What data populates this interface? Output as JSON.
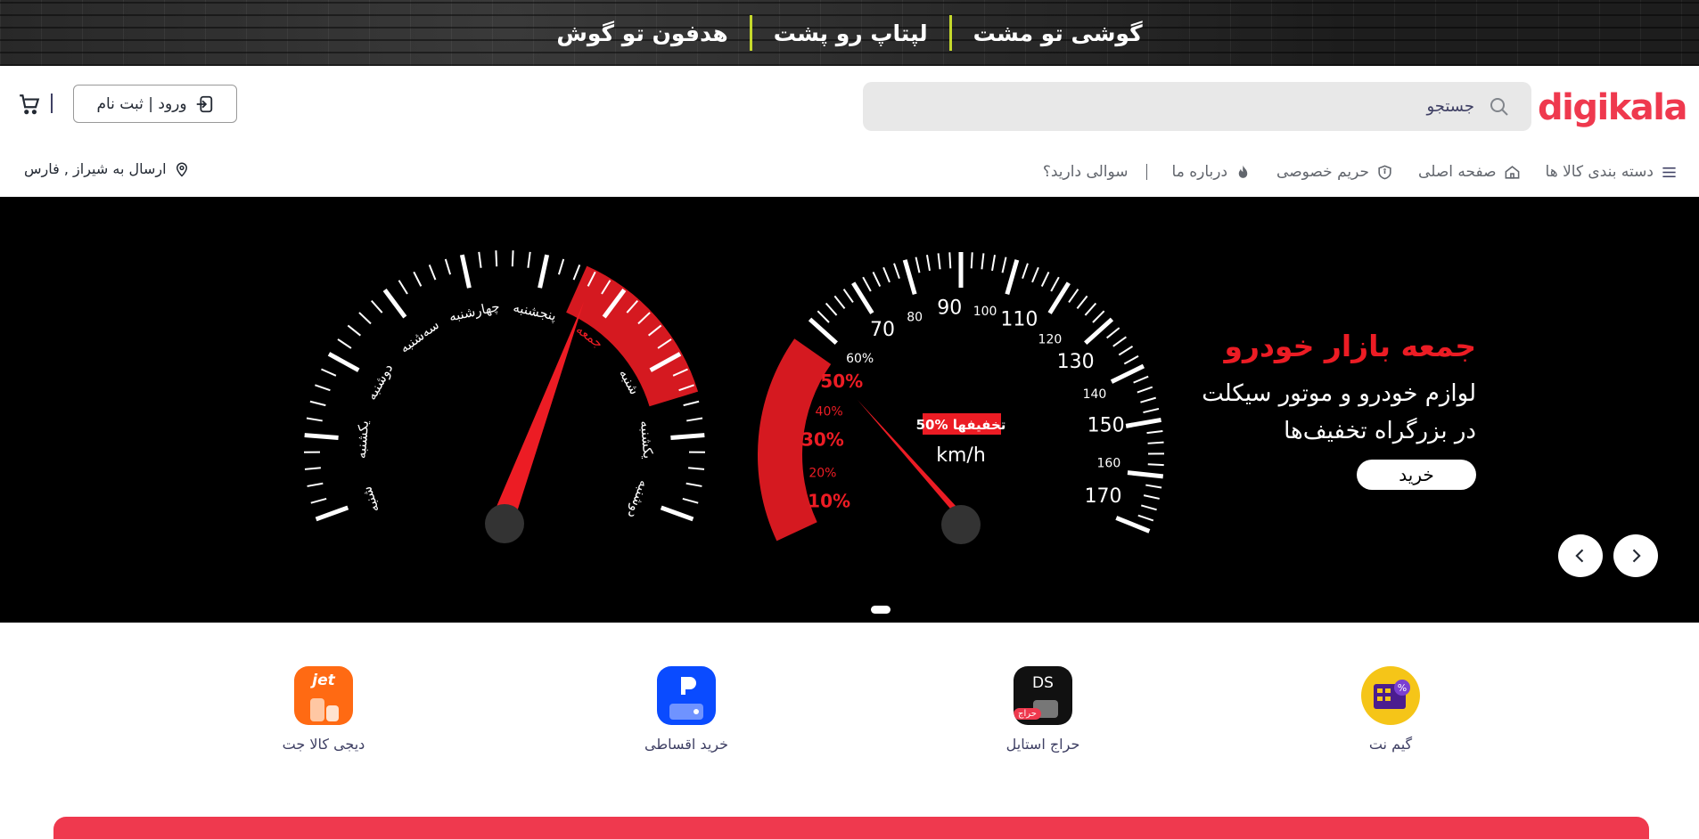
{
  "promo": {
    "items": [
      "گوشی تو مشت",
      "لپتاپ رو پشت",
      "هدفون تو گوش"
    ],
    "separator_color": "#c5d92c"
  },
  "header": {
    "logo": "digikala",
    "search_placeholder": "جستجو",
    "login_label": "ورود | ثبت نام",
    "cart_icon": "cart-icon"
  },
  "nav": {
    "items": [
      {
        "label": "دسته بندی کالا ها",
        "icon": "menu-icon"
      },
      {
        "label": "صفحه اصلی",
        "icon": "home-icon"
      },
      {
        "label": "حریم خصوصی",
        "icon": "shield-icon"
      },
      {
        "label": "درباره ما",
        "icon": "fire-icon"
      },
      {
        "label": "سوالی دارید؟",
        "icon": ""
      }
    ],
    "location": "ارسال به شیراز , فارس"
  },
  "hero": {
    "title": "جمعه بازار خودرو",
    "subtitle_line1": "لوازم خودرو و موتور سیکلت",
    "subtitle_line2": "در بزرگراه تخفیف‌ها",
    "button": "خرید",
    "accent_color": "#ec1c24",
    "left_gauge_days": [
      "شنبه",
      "یکشنبه",
      "دوشنبه",
      "سه‌شنبه",
      "چهارشنبه",
      "پنجشنبه",
      "جمعه",
      "شنبه",
      "یکشنبه",
      "دوشنبه"
    ],
    "right_gauge_numbers": [
      "70",
      "80",
      "90",
      "100",
      "110",
      "120",
      "130",
      "140",
      "150",
      "160",
      "170"
    ],
    "right_gauge_percents": [
      "10%",
      "20%",
      "30%",
      "40%",
      "50%",
      "60%"
    ],
    "speed_unit": "km/h",
    "badge_percent": "50%",
    "badge_text": "تخفیفها"
  },
  "quick_links": [
    {
      "label": "گیم نت",
      "icon": "gamenet-icon",
      "color": "#f5c518"
    },
    {
      "label": "حراج استایل",
      "icon": "style-sale-icon",
      "color": "#111111",
      "badge": "حراج",
      "text": "DS"
    },
    {
      "label": "خرید اقساطی",
      "icon": "installment-icon",
      "color": "#0a4bff"
    },
    {
      "label": "دیجی کالا جت",
      "icon": "jet-icon",
      "color": "#ff6a13",
      "text": "jet"
    }
  ]
}
